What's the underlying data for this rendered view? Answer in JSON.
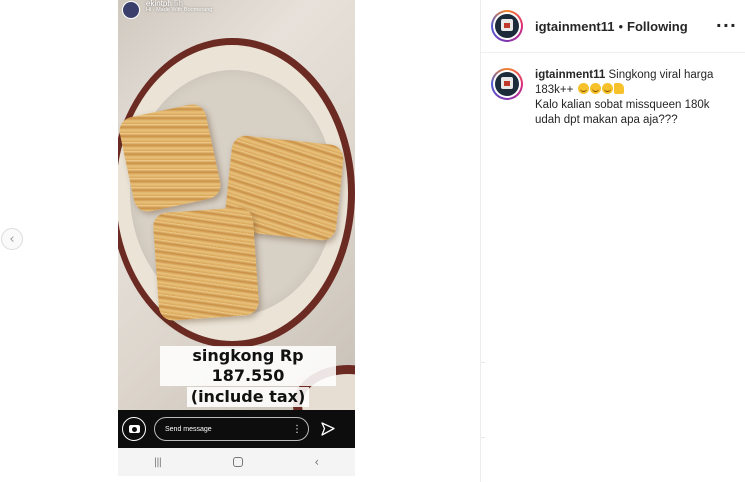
{
  "story": {
    "username": "ekintph",
    "time": "5h",
    "subtitle": "Hi · Made With Boomerang",
    "caption_line1": "singkong Rp 187.550",
    "caption_line2": "(include tax)",
    "message_placeholder": "Send message"
  },
  "post": {
    "username": "igtainment11",
    "separator": "•",
    "follow_status": "Following",
    "comment": {
      "username": "igtainment11",
      "line1": "Singkong viral harga 183k++",
      "line2": "Kalo kalian sobat missqueen 180k udah dpt makan apa aja???"
    }
  },
  "icons": {
    "prev": "chevron-left-icon",
    "more": "more-horizontal-icon",
    "camera": "camera-icon",
    "send": "send-icon",
    "story_more": "more-vertical-icon",
    "nav_recents": "recents-icon",
    "nav_home": "home-icon",
    "nav_back": "back-icon",
    "emoji": "laughing-emoji-icon",
    "thumbs_up": "thumbs-up-emoji-icon"
  },
  "colors": {
    "text_primary": "#262626",
    "plate_rim": "#6b2a22",
    "story_bar": "#0d0d0d"
  }
}
